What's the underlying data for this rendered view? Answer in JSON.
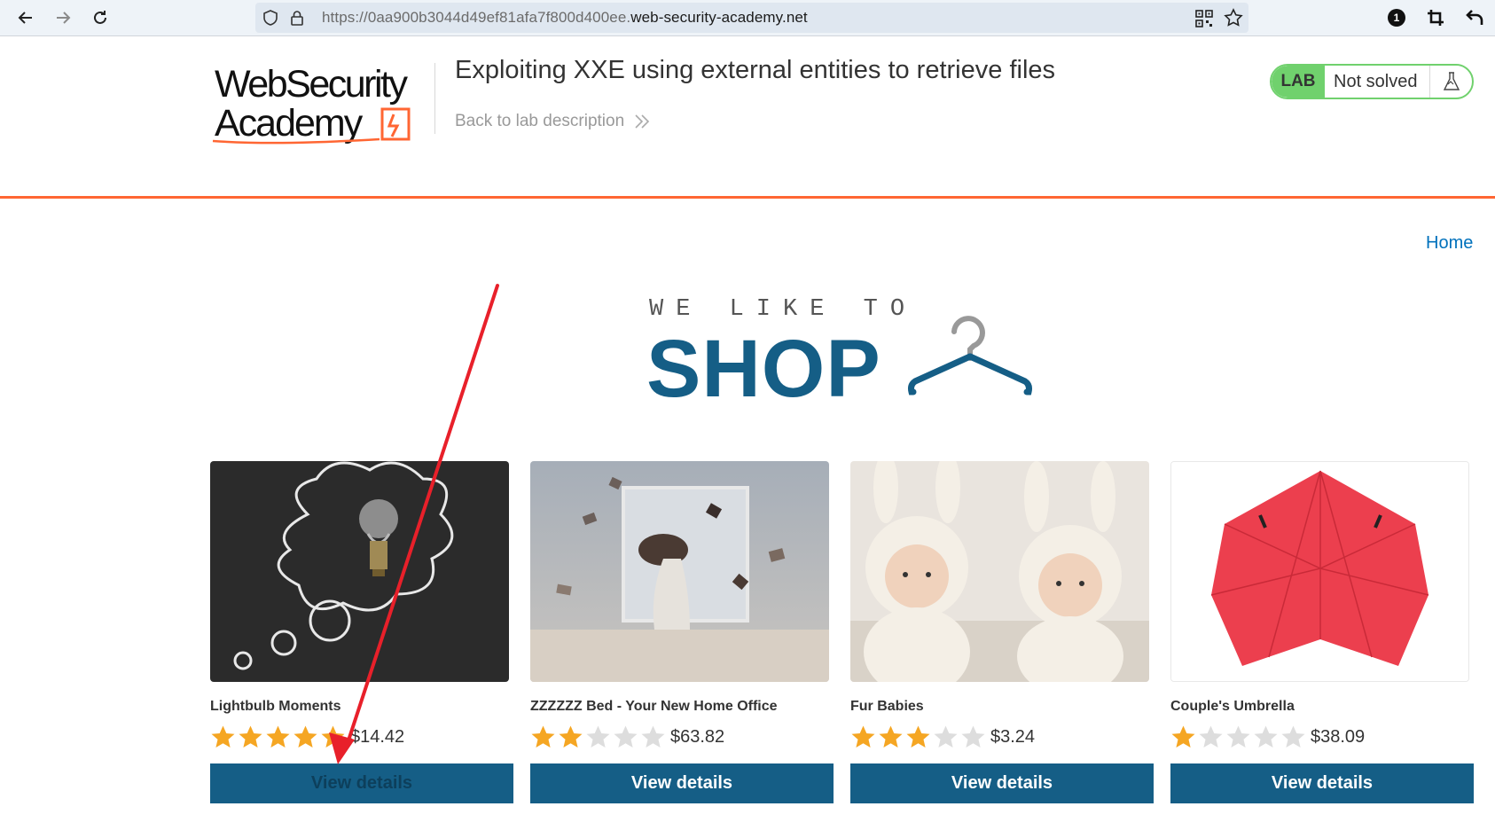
{
  "browser": {
    "url_prefix": "https://0aa900b3044d49ef81afa7f800d400ee.",
    "url_host": "web-security-academy.net",
    "icons": [
      "back-arrow-icon",
      "forward-arrow-icon",
      "reload-icon",
      "shield-icon",
      "lock-icon",
      "qr-code-icon",
      "bookmark-star-icon",
      "extension-badge-icon",
      "crop-icon",
      "undo-icon"
    ],
    "extension_badge": "1"
  },
  "lab": {
    "logo_line1": "WebSecurity",
    "logo_line2": "Academy",
    "title": "Exploiting XXE using external entities to retrieve files",
    "back_link": "Back to lab description",
    "status_pill": "LAB",
    "status_text": "Not solved"
  },
  "nav": {
    "home": "Home"
  },
  "banner": {
    "line1": "WE LIKE TO",
    "line2": "SHOP"
  },
  "products": [
    {
      "name": "Lightbulb Moments",
      "rating": 5,
      "price": "$14.42",
      "button": "View details"
    },
    {
      "name": "ZZZZZZ Bed - Your New Home Office",
      "rating": 2,
      "price": "$63.82",
      "button": "View details"
    },
    {
      "name": "Fur Babies",
      "rating": 3,
      "price": "$3.24",
      "button": "View details"
    },
    {
      "name": "Couple's Umbrella",
      "rating": 1,
      "price": "$38.09",
      "button": "View details"
    }
  ],
  "colors": {
    "accent_orange": "#ff6633",
    "lab_green": "#70d16d",
    "shop_blue": "#155e86",
    "star_gold": "#f5a623",
    "star_gray": "#dddddd",
    "annotation_red": "#e8202a"
  }
}
